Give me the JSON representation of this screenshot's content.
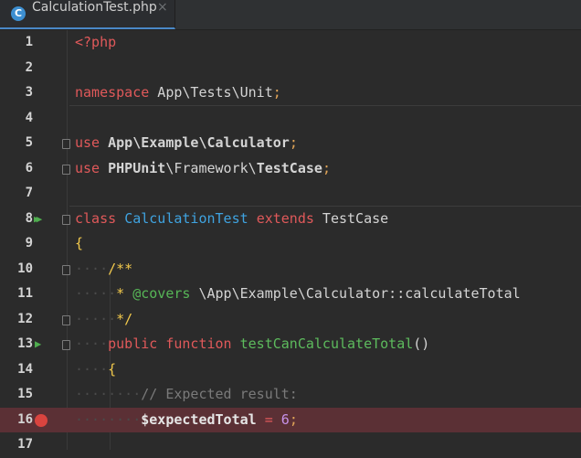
{
  "tab": {
    "icon_letter": "C",
    "filename": "CalculationTest.php",
    "close_glyph": "×"
  },
  "editor": {
    "lines": [
      {
        "num": "1",
        "text": "<?php"
      },
      {
        "num": "2",
        "text": ""
      },
      {
        "num": "3",
        "text": "namespace App\\Tests\\Unit;"
      },
      {
        "num": "4",
        "text": ""
      },
      {
        "num": "5",
        "text": "use App\\Example\\Calculator;"
      },
      {
        "num": "6",
        "text": "use PHPUnit\\Framework\\TestCase;"
      },
      {
        "num": "7",
        "text": ""
      },
      {
        "num": "8",
        "text": "class CalculationTest extends TestCase"
      },
      {
        "num": "9",
        "text": "{"
      },
      {
        "num": "10",
        "text": "    /**"
      },
      {
        "num": "11",
        "text": "     * @covers \\App\\Example\\Calculator::calculateTotal"
      },
      {
        "num": "12",
        "text": "     */"
      },
      {
        "num": "13",
        "text": "    public function testCanCalculateTotal()"
      },
      {
        "num": "14",
        "text": "    {"
      },
      {
        "num": "15",
        "text": "        // Expected result:"
      },
      {
        "num": "16",
        "text": "        $expectedTotal = 6;"
      },
      {
        "num": "17",
        "text": ""
      }
    ],
    "highlighted_line": "16",
    "highlight_color": "#5b3035",
    "gutter_icons": {
      "run_class": "run-class-icon",
      "run_method": "run-method-icon",
      "breakpoint": "breakpoint-icon",
      "fold": "fold-icon"
    }
  }
}
